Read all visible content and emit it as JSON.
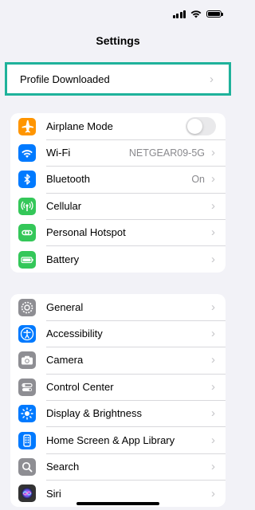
{
  "header": {
    "title": "Settings"
  },
  "profile": {
    "label": "Profile Downloaded"
  },
  "colors": {
    "highlight": "#1fb29b"
  },
  "group1": [
    {
      "label": "Airplane Mode",
      "icon": "airplane-icon",
      "color": "#ff9500",
      "control": "toggle",
      "toggle_on": false
    },
    {
      "label": "Wi-Fi",
      "icon": "wifi-icon",
      "color": "#007aff",
      "value": "NETGEAR09-5G"
    },
    {
      "label": "Bluetooth",
      "icon": "bluetooth-icon",
      "color": "#007aff",
      "value": "On"
    },
    {
      "label": "Cellular",
      "icon": "cellular-icon",
      "color": "#34c759"
    },
    {
      "label": "Personal Hotspot",
      "icon": "hotspot-icon",
      "color": "#34c759"
    },
    {
      "label": "Battery",
      "icon": "battery-icon",
      "color": "#34c759"
    }
  ],
  "group2": [
    {
      "label": "General",
      "icon": "gear-icon",
      "color": "#8e8e93"
    },
    {
      "label": "Accessibility",
      "icon": "accessibility-icon",
      "color": "#007aff"
    },
    {
      "label": "Camera",
      "icon": "camera-icon",
      "color": "#8e8e93"
    },
    {
      "label": "Control Center",
      "icon": "control-center-icon",
      "color": "#8e8e93"
    },
    {
      "label": "Display & Brightness",
      "icon": "sun-icon",
      "color": "#007aff"
    },
    {
      "label": "Home Screen & App Library",
      "icon": "home-screen-icon",
      "color": "#007aff"
    },
    {
      "label": "Search",
      "icon": "search-icon",
      "color": "#8e8e93"
    },
    {
      "label": "Siri",
      "icon": "siri-icon",
      "color": "#333333"
    }
  ]
}
